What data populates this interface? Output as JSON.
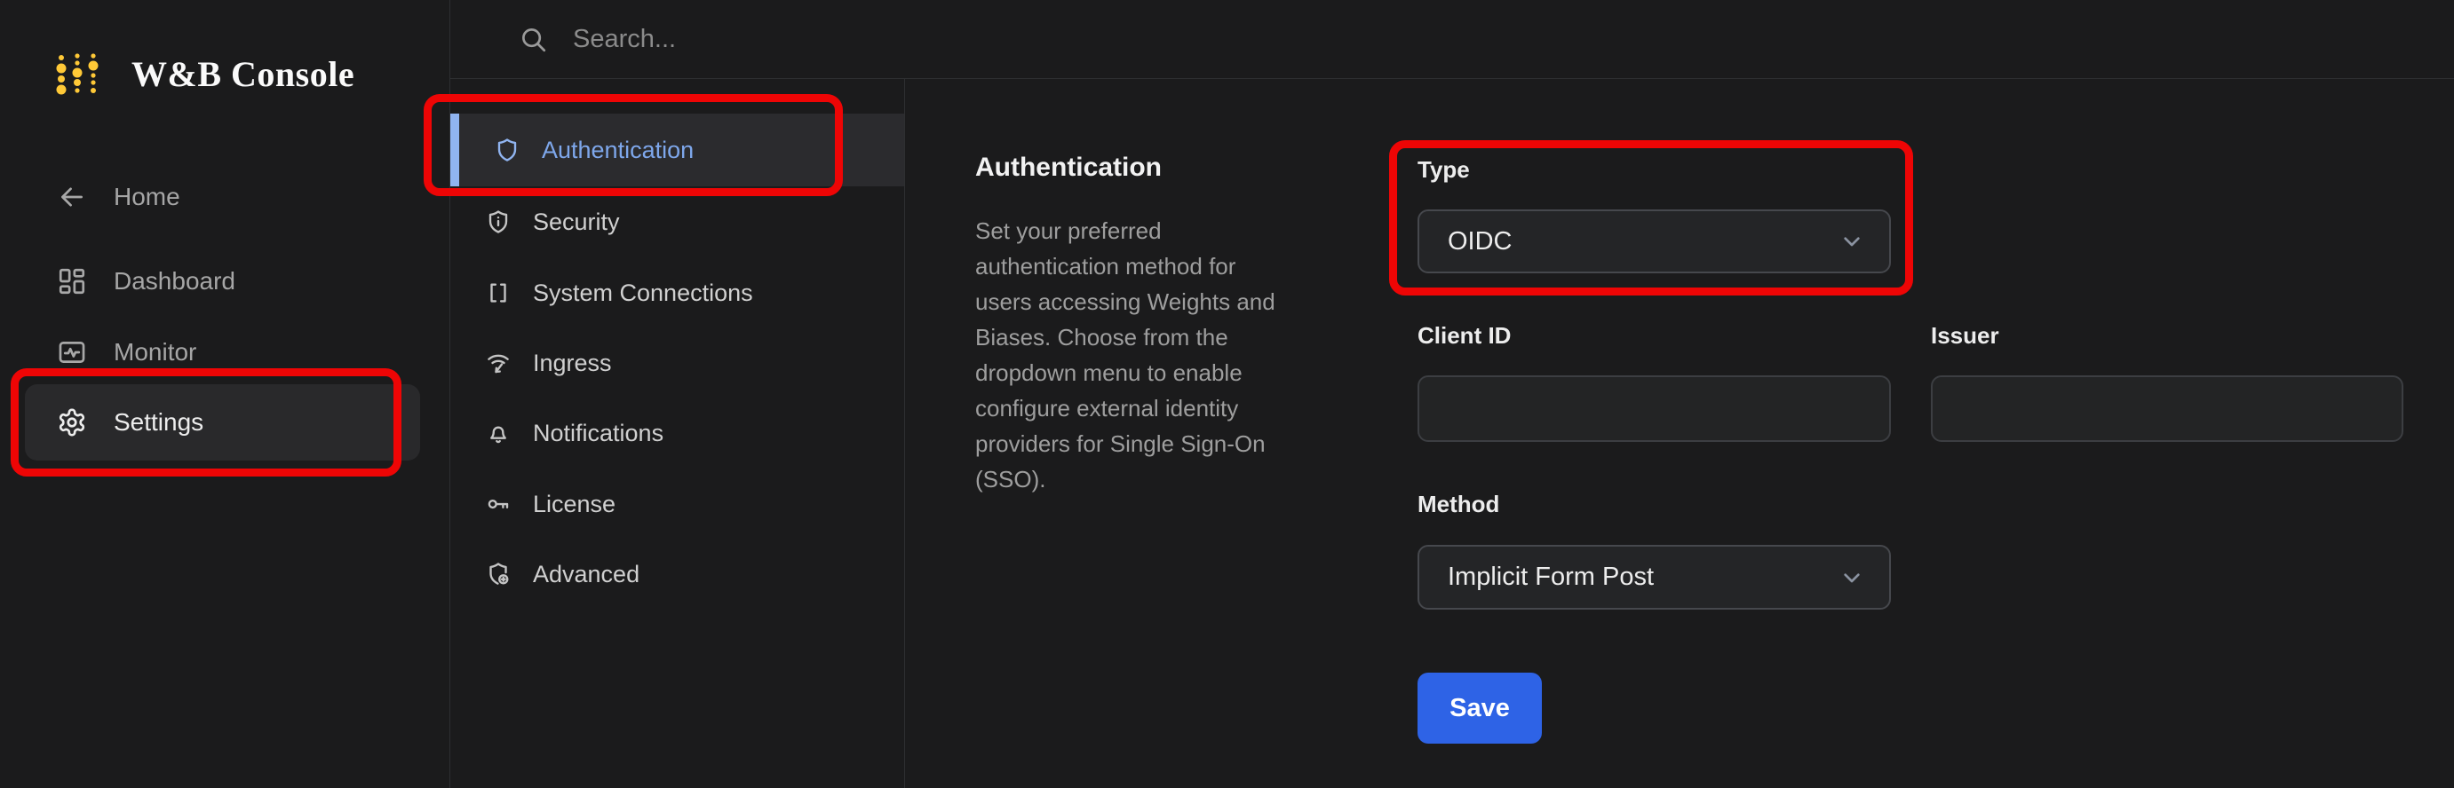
{
  "app": {
    "title": "W&B Console"
  },
  "topbar": {
    "search_placeholder": "Search..."
  },
  "sidebar": {
    "items": [
      {
        "label": "Home",
        "icon": "arrow-left-icon",
        "active": false
      },
      {
        "label": "Dashboard",
        "icon": "dashboard-icon",
        "active": false
      },
      {
        "label": "Monitor",
        "icon": "monitor-icon",
        "active": false
      },
      {
        "label": "Settings",
        "icon": "gear-icon",
        "active": true
      }
    ]
  },
  "settings_nav": {
    "items": [
      {
        "label": "Authentication",
        "icon": "shield-icon",
        "active": true
      },
      {
        "label": "Security",
        "icon": "shield-info-icon",
        "active": false
      },
      {
        "label": "System Connections",
        "icon": "brackets-icon",
        "active": false
      },
      {
        "label": "Ingress",
        "icon": "ingress-icon",
        "active": false
      },
      {
        "label": "Notifications",
        "icon": "bell-icon",
        "active": false
      },
      {
        "label": "License",
        "icon": "key-icon",
        "active": false
      },
      {
        "label": "Advanced",
        "icon": "shield-cog-icon",
        "active": false
      }
    ]
  },
  "content": {
    "title": "Authentication",
    "description": "Set your preferred authentication method for users accessing Weights and Biases. Choose from the dropdown menu to enable configure external identity providers for Single Sign-On (SSO).",
    "form": {
      "type": {
        "label": "Type",
        "value": "OIDC"
      },
      "client_id": {
        "label": "Client ID",
        "value": ""
      },
      "issuer": {
        "label": "Issuer",
        "value": ""
      },
      "method": {
        "label": "Method",
        "value": "Implicit Form Post"
      },
      "save_label": "Save"
    }
  },
  "annotations": {
    "boxes": [
      "settings-sidebar-item",
      "authentication-nav-item",
      "type-dropdown-group"
    ]
  },
  "colors": {
    "background": "#1b1b1c",
    "active_text_blue": "#7ea7eb",
    "active_bar_blue": "#90b4f0",
    "save_button_blue": "#2e63e6",
    "logo_gold": "#ffc937",
    "annotation_red": "#ee0505"
  }
}
